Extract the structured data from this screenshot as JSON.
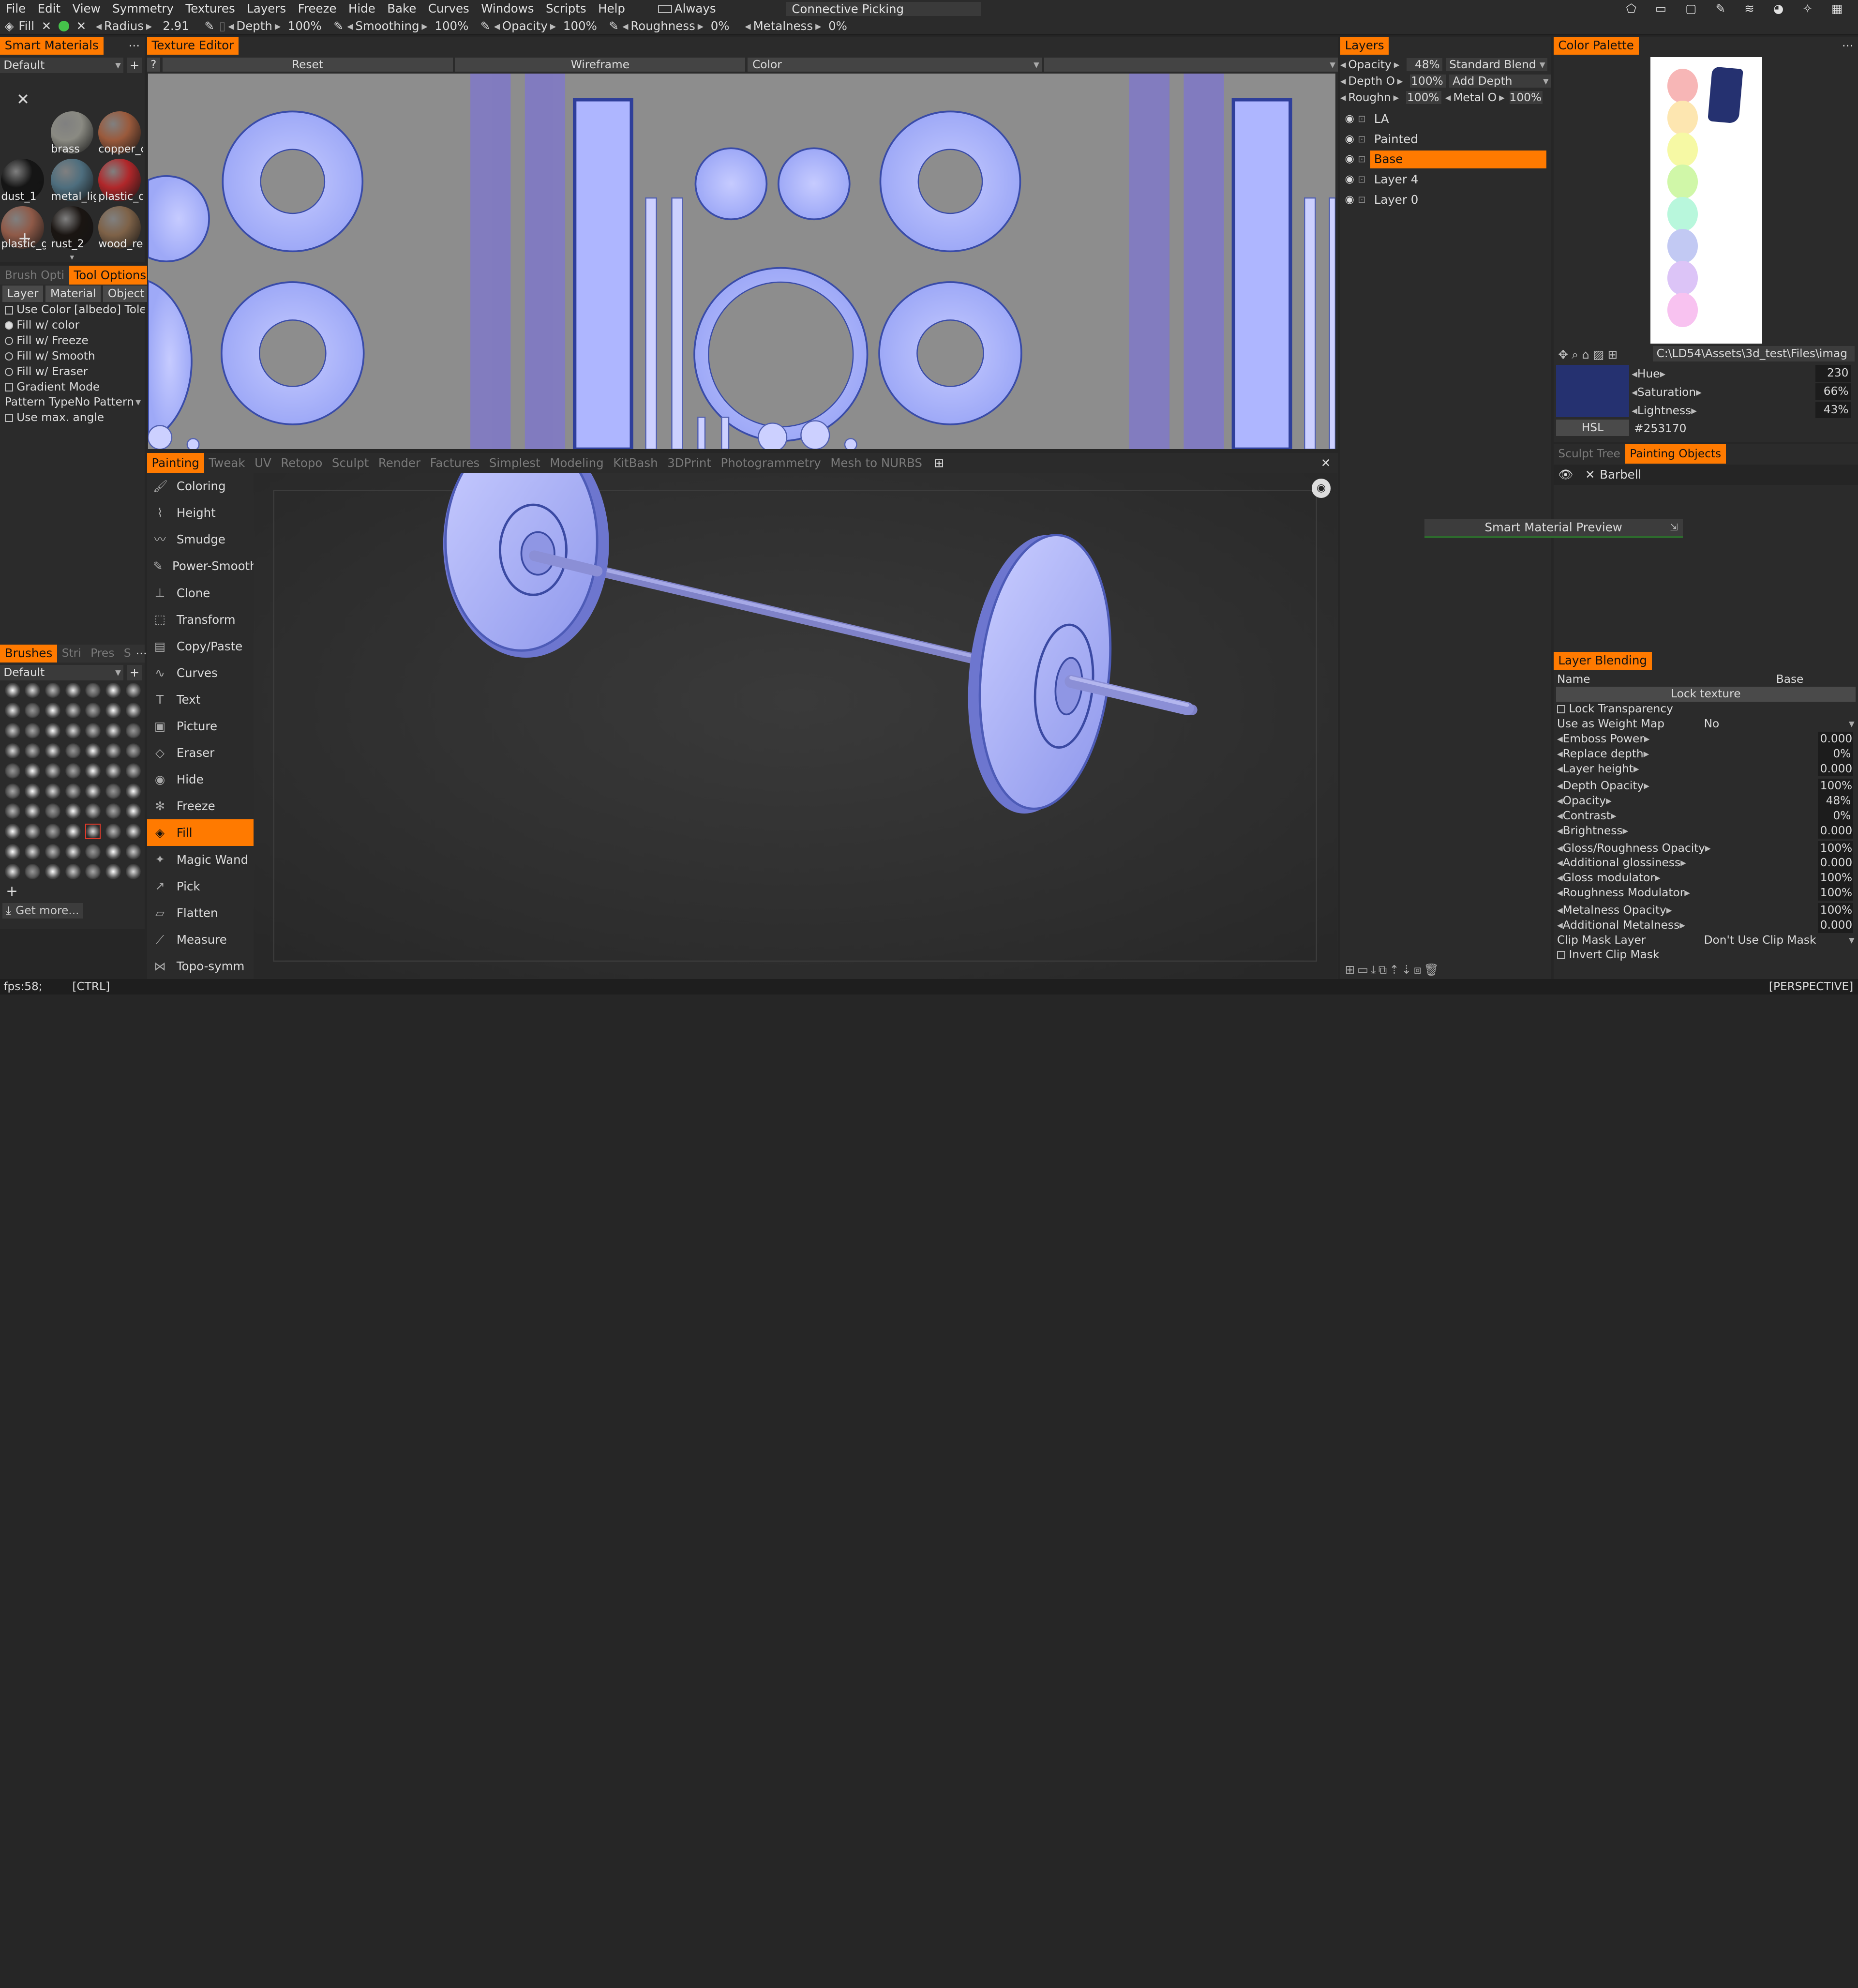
{
  "menu": [
    "File",
    "Edit",
    "View",
    "Symmetry",
    "Textures",
    "Layers",
    "Freeze",
    "Hide",
    "Bake",
    "Curves",
    "Windows",
    "Scripts",
    "Help"
  ],
  "always": {
    "label": "Always",
    "picking": "Connective Picking"
  },
  "toolbar": {
    "tool": "Fill",
    "radius": {
      "label": "Radius",
      "value": "2.91"
    },
    "depth": {
      "label": "Depth",
      "value": "100%"
    },
    "smoothing": {
      "label": "Smoothing",
      "value": "100%"
    },
    "opacity": {
      "label": "Opacity",
      "value": "100%"
    },
    "roughness": {
      "label": "Roughness",
      "value": "0%"
    },
    "metalness": {
      "label": "Metalness",
      "value": "0%"
    }
  },
  "smart_materials": {
    "title": "Smart Materials",
    "preset": "Default",
    "items": [
      {
        "name": "brass",
        "color": "#8a8a82"
      },
      {
        "name": "copper_c",
        "color": "#9a5a3c"
      },
      {
        "name": "dust_1",
        "color": "#151515"
      },
      {
        "name": "metal_lig",
        "color": "#4e6e7e"
      },
      {
        "name": "plastic_d",
        "color": "#b0272a"
      },
      {
        "name": "plastic_g",
        "color": "#8f5a48"
      },
      {
        "name": "rust_2",
        "color": "#1a1512"
      },
      {
        "name": "wood_re",
        "color": "#7e6248"
      }
    ]
  },
  "tool_options": {
    "tabs": [
      "Brush Opti",
      "Tool Options"
    ],
    "subtabs": [
      "Layer",
      "Material",
      "Object"
    ],
    "use_color": "Use Color [albedo] Tole",
    "fill_options": [
      "Fill w/ color",
      "Fill w/ Freeze",
      "Fill w/ Smooth",
      "Fill w/ Eraser"
    ],
    "gradient": "Gradient Mode",
    "pattern_type": "Pattern Type",
    "pattern_value": "No Pattern",
    "max_angle": "Use max. angle"
  },
  "brushes": {
    "tabs": [
      "Brushes",
      "Stri",
      "Pres",
      "S"
    ],
    "preset": "Default",
    "get_more": "Get more..."
  },
  "texture_editor": {
    "title": "Texture Editor",
    "help": "?",
    "reset": "Reset",
    "wireframe": "Wireframe",
    "color": "Color"
  },
  "room_tabs": [
    "Painting",
    "Tweak",
    "UV",
    "Retopo",
    "Sculpt",
    "Render",
    "Factures",
    "Simplest",
    "Modeling",
    "KitBash",
    "3DPrint",
    "Photogrammetry",
    "Mesh to NURBS"
  ],
  "tools": [
    {
      "name": "Coloring",
      "icon": "brush-icon"
    },
    {
      "name": "Height",
      "icon": "height-icon"
    },
    {
      "name": "Smudge",
      "icon": "smudge-icon"
    },
    {
      "name": "Power-Smooth",
      "icon": "smooth-icon"
    },
    {
      "name": "Clone",
      "icon": "clone-icon"
    },
    {
      "name": "Transform",
      "icon": "transform-icon"
    },
    {
      "name": "Copy/Paste",
      "icon": "copy-icon"
    },
    {
      "name": "Curves",
      "icon": "curves-icon"
    },
    {
      "name": "Text",
      "icon": "text-icon"
    },
    {
      "name": "Picture",
      "icon": "picture-icon"
    },
    {
      "name": "Eraser",
      "icon": "eraser-icon"
    },
    {
      "name": "Hide",
      "icon": "eye-icon"
    },
    {
      "name": "Freeze",
      "icon": "freeze-icon"
    },
    {
      "name": "Fill",
      "icon": "fill-icon"
    },
    {
      "name": "Magic Wand",
      "icon": "wand-icon"
    },
    {
      "name": "Pick",
      "icon": "pick-icon"
    },
    {
      "name": "Flatten",
      "icon": "flatten-icon"
    },
    {
      "name": "Measure",
      "icon": "measure-icon"
    },
    {
      "name": "Topo-symm",
      "icon": "symmetry-icon"
    }
  ],
  "active_tool": "Fill",
  "layers": {
    "title": "Layers",
    "opacity": {
      "label": "Opacity",
      "value": "48%"
    },
    "blend": "Standard Blend",
    "depth": {
      "label": "Depth O",
      "value": "100%"
    },
    "add_depth": "Add Depth",
    "rough": {
      "label": "Roughn",
      "value": "100%"
    },
    "metal": {
      "label": "Metal O",
      "value": "100%"
    },
    "items": [
      "LA",
      "Painted",
      "Base",
      "Layer 4",
      "Layer 0"
    ],
    "selected": "Base"
  },
  "color_palette": {
    "title": "Color Palette",
    "path": "C:\\LD54\\Assets\\3d_test\\Files\\imag",
    "swatches": [
      "#f7b6b6",
      "#fde6b0",
      "#f6f9a4",
      "#d0f7a8",
      "#b8f7dc",
      "#c2c9f3",
      "#dcc4f7",
      "#f8c2f0"
    ],
    "selected": "#253170",
    "hue": {
      "label": "Hue",
      "value": "230"
    },
    "saturation": {
      "label": "Saturation",
      "value": "66%"
    },
    "lightness": {
      "label": "Lightness",
      "value": "43%"
    },
    "mode": "HSL",
    "hex": "#253170"
  },
  "objects": {
    "tabs": [
      "Sculpt Tree",
      "Painting Objects"
    ],
    "items": [
      "Barbell"
    ]
  },
  "smart_preview": "Smart Material Preview",
  "layer_blending": {
    "title": "Layer Blending",
    "name_label": "Name",
    "name_value": "Base",
    "lock_texture": "Lock texture",
    "lock_transparency": "Lock Transparency",
    "weight_map": {
      "label": "Use as Weight Map",
      "value": "No"
    },
    "props": [
      {
        "label": "Emboss Power",
        "value": "0.000"
      },
      {
        "label": "Replace depth",
        "value": "0%"
      },
      {
        "label": "Layer height",
        "value": "0.000"
      },
      {
        "label": "Depth Opacity",
        "value": "100%"
      },
      {
        "label": "Opacity",
        "value": "48%"
      },
      {
        "label": "Contrast",
        "value": "0%"
      },
      {
        "label": "Brightness",
        "value": "0.000"
      },
      {
        "label": "Gloss/Roughness Opacity",
        "value": "100%"
      },
      {
        "label": "Additional glossiness",
        "value": "0.000"
      },
      {
        "label": "Gloss modulator",
        "value": "100%"
      },
      {
        "label": "Roughness Modulator",
        "value": "100%"
      },
      {
        "label": "Metalness Opacity",
        "value": "100%"
      },
      {
        "label": "Additional Metalness",
        "value": "0.000"
      }
    ],
    "clip_mask": {
      "label": "Clip Mask Layer",
      "value": "Don't Use Clip Mask"
    },
    "invert": "Invert Clip Mask"
  },
  "status": {
    "fps": "fps:58;",
    "ctrl": "[CTRL]",
    "view": "[PERSPECTIVE]"
  },
  "colors": {
    "accent": "#ff7a00",
    "uv_fill": "#b4bcff",
    "uv_edge": "#3a4ca8"
  }
}
